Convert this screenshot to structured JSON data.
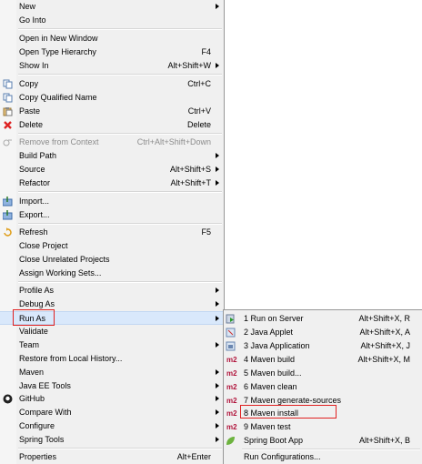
{
  "menu": {
    "items": [
      {
        "label": "New",
        "accel": "",
        "arrow": true
      },
      {
        "label": "Go Into",
        "accel": "",
        "arrow": false
      },
      {
        "label": "Open in New Window",
        "accel": "",
        "arrow": false
      },
      {
        "label": "Open Type Hierarchy",
        "accel": "F4",
        "arrow": false
      },
      {
        "label": "Show In",
        "accel": "Alt+Shift+W",
        "arrow": true
      },
      {
        "label": "Copy",
        "accel": "Ctrl+C",
        "arrow": false
      },
      {
        "label": "Copy Qualified Name",
        "accel": "",
        "arrow": false
      },
      {
        "label": "Paste",
        "accel": "Ctrl+V",
        "arrow": false
      },
      {
        "label": "Delete",
        "accel": "Delete",
        "arrow": false
      },
      {
        "label": "Remove from Context",
        "accel": "Ctrl+Alt+Shift+Down",
        "arrow": false
      },
      {
        "label": "Build Path",
        "accel": "",
        "arrow": true
      },
      {
        "label": "Source",
        "accel": "Alt+Shift+S",
        "arrow": true
      },
      {
        "label": "Refactor",
        "accel": "Alt+Shift+T",
        "arrow": true
      },
      {
        "label": "Import...",
        "accel": "",
        "arrow": false
      },
      {
        "label": "Export...",
        "accel": "",
        "arrow": false
      },
      {
        "label": "Refresh",
        "accel": "F5",
        "arrow": false
      },
      {
        "label": "Close Project",
        "accel": "",
        "arrow": false
      },
      {
        "label": "Close Unrelated Projects",
        "accel": "",
        "arrow": false
      },
      {
        "label": "Assign Working Sets...",
        "accel": "",
        "arrow": false
      },
      {
        "label": "Profile As",
        "accel": "",
        "arrow": true
      },
      {
        "label": "Debug As",
        "accel": "",
        "arrow": true
      },
      {
        "label": "Run As",
        "accel": "",
        "arrow": true
      },
      {
        "label": "Validate",
        "accel": "",
        "arrow": false
      },
      {
        "label": "Team",
        "accel": "",
        "arrow": true
      },
      {
        "label": "Restore from Local History...",
        "accel": "",
        "arrow": false
      },
      {
        "label": "Maven",
        "accel": "",
        "arrow": true
      },
      {
        "label": "Java EE Tools",
        "accel": "",
        "arrow": true
      },
      {
        "label": "GitHub",
        "accel": "",
        "arrow": true
      },
      {
        "label": "Compare With",
        "accel": "",
        "arrow": true
      },
      {
        "label": "Configure",
        "accel": "",
        "arrow": true
      },
      {
        "label": "Spring Tools",
        "accel": "",
        "arrow": true
      },
      {
        "label": "Properties",
        "accel": "Alt+Enter",
        "arrow": false
      }
    ]
  },
  "submenu": {
    "badge": "m2",
    "items": [
      {
        "label": "1 Run on Server",
        "accel": "Alt+Shift+X, R"
      },
      {
        "label": "2 Java Applet",
        "accel": "Alt+Shift+X, A"
      },
      {
        "label": "3 Java Application",
        "accel": "Alt+Shift+X, J"
      },
      {
        "label": "4 Maven build",
        "accel": "Alt+Shift+X, M"
      },
      {
        "label": "5 Maven build...",
        "accel": ""
      },
      {
        "label": "6 Maven clean",
        "accel": ""
      },
      {
        "label": "7 Maven generate-sources",
        "accel": ""
      },
      {
        "label": "8 Maven install",
        "accel": ""
      },
      {
        "label": "9 Maven test",
        "accel": ""
      },
      {
        "label": "Spring Boot App",
        "accel": "Alt+Shift+X, B"
      },
      {
        "label": "Run Configurations...",
        "accel": ""
      }
    ]
  },
  "colors": {
    "highlight_box": "#e02020",
    "hover_bg": "#d9e8fb",
    "menu_bg": "#f0f0f0"
  }
}
